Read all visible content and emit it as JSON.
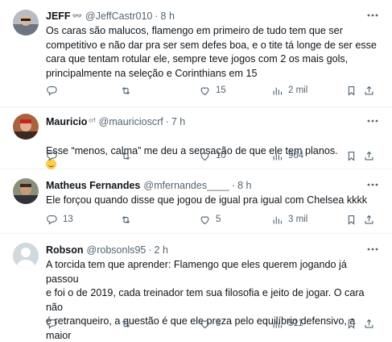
{
  "tweets": [
    {
      "name": "JEFF",
      "badge": "👓",
      "handle": "@JeffCastr010",
      "sep": "·",
      "time": "8 h",
      "text": "Os caras são malucos, flamengo em primeiro de tudo tem que ser\ncompetitivo e não dar pra ser sem defes boa, e o tite tá longe de ser esse\ncara que tentam rotular ele, sempre teve jogos com 2 os mais gols,\nprincipalmente na seleção e Corinthians em 15",
      "replies": "",
      "retweets": "",
      "likes": "15",
      "views": "2 mil"
    },
    {
      "name": "Mauricio",
      "badge": "ᶜʳᶠ",
      "handle": "@mauricioscrf",
      "sep": "·",
      "time": "7 h",
      "text": "Esse “menos, calma” me deu a sensação de que ele tem planos.",
      "replies": "",
      "retweets": "",
      "likes": "10",
      "views": "964"
    },
    {
      "name": "Matheus Fernandes",
      "badge": "",
      "handle": "@mfernandes____",
      "sep": "·",
      "time": "8 h",
      "text": "Ele forçou quando disse que jogou de igual pra igual com Chelsea kkkk",
      "replies": "13",
      "retweets": "",
      "likes": "5",
      "views": "3 mil"
    },
    {
      "name": "Robson",
      "badge": "",
      "handle": "@robsonls95",
      "sep": "·",
      "time": "2 h",
      "text": "A torcida tem que aprender: Flamengo que eles querem jogando já passou\ne foi o de 2019, cada treinador tem sua filosofia e jeito de jogar. O cara não\né retranqueiro, a questão é que ele preza pelo equilíbrio defensivo, a maior\nprova de fogo será no domingo.",
      "replies": "",
      "retweets": "",
      "likes": "3",
      "views": "511"
    }
  ],
  "colors": {
    "text": "#0f1419",
    "secondary": "#536471",
    "divider": "#eff3f4"
  }
}
